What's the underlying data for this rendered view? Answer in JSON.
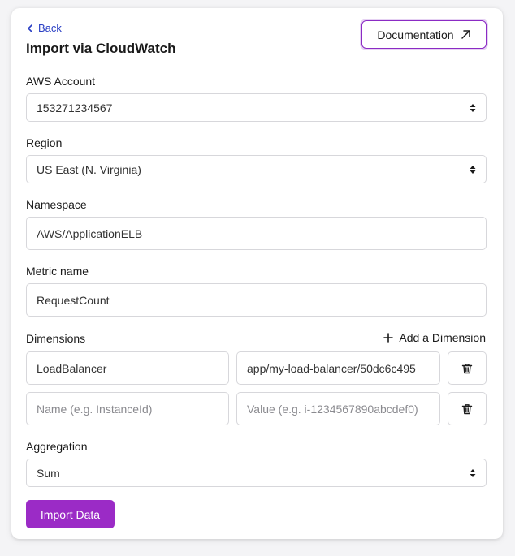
{
  "header": {
    "back_label": "Back",
    "title": "Import via CloudWatch",
    "documentation_label": "Documentation"
  },
  "form": {
    "aws_account": {
      "label": "AWS Account",
      "value": "153271234567"
    },
    "region": {
      "label": "Region",
      "value": "US East (N. Virginia)"
    },
    "namespace": {
      "label": "Namespace",
      "value": "AWS/ApplicationELB"
    },
    "metric_name": {
      "label": "Metric name",
      "value": "RequestCount"
    },
    "dimensions": {
      "label": "Dimensions",
      "add_label": "Add a Dimension",
      "rows": [
        {
          "name": "LoadBalancer",
          "value": "app/my-load-balancer/50dc6c495"
        },
        {
          "name_placeholder": "Name (e.g. InstanceId)",
          "value_placeholder": "Value (e.g. i-1234567890abcdef0)"
        }
      ]
    },
    "aggregation": {
      "label": "Aggregation",
      "value": "Sum"
    },
    "submit_label": "Import Data"
  },
  "colors": {
    "accent": "#9b2bc6",
    "link": "#2a3fc4",
    "border": "#d7d7db"
  },
  "icons": {
    "back": "chevron-left-icon",
    "documentation": "arrow-up-right-icon",
    "select": "sort-caret-icon",
    "add": "plus-icon",
    "delete": "trash-icon"
  }
}
